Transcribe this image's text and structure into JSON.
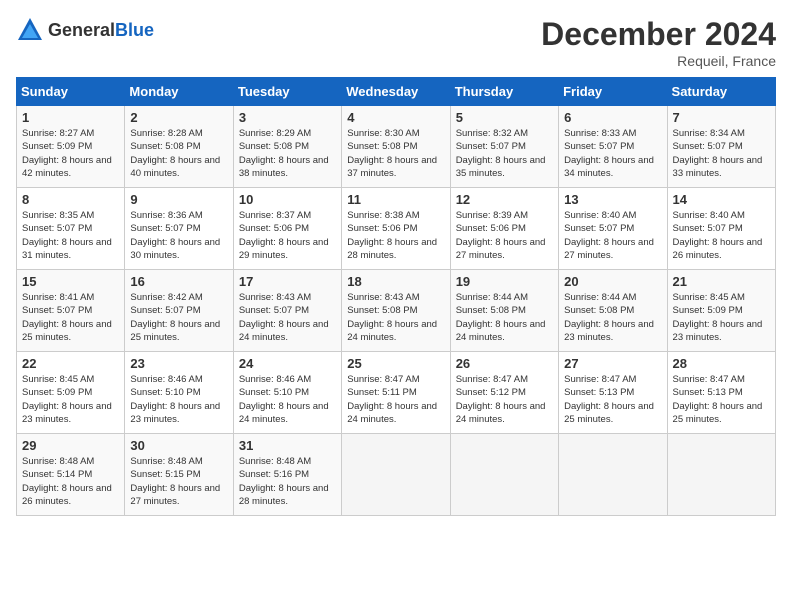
{
  "header": {
    "logo_general": "General",
    "logo_blue": "Blue",
    "month_title": "December 2024",
    "location": "Requeil, France"
  },
  "weekdays": [
    "Sunday",
    "Monday",
    "Tuesday",
    "Wednesday",
    "Thursday",
    "Friday",
    "Saturday"
  ],
  "weeks": [
    [
      {
        "day": "1",
        "sunrise": "Sunrise: 8:27 AM",
        "sunset": "Sunset: 5:09 PM",
        "daylight": "Daylight: 8 hours and 42 minutes."
      },
      {
        "day": "2",
        "sunrise": "Sunrise: 8:28 AM",
        "sunset": "Sunset: 5:08 PM",
        "daylight": "Daylight: 8 hours and 40 minutes."
      },
      {
        "day": "3",
        "sunrise": "Sunrise: 8:29 AM",
        "sunset": "Sunset: 5:08 PM",
        "daylight": "Daylight: 8 hours and 38 minutes."
      },
      {
        "day": "4",
        "sunrise": "Sunrise: 8:30 AM",
        "sunset": "Sunset: 5:08 PM",
        "daylight": "Daylight: 8 hours and 37 minutes."
      },
      {
        "day": "5",
        "sunrise": "Sunrise: 8:32 AM",
        "sunset": "Sunset: 5:07 PM",
        "daylight": "Daylight: 8 hours and 35 minutes."
      },
      {
        "day": "6",
        "sunrise": "Sunrise: 8:33 AM",
        "sunset": "Sunset: 5:07 PM",
        "daylight": "Daylight: 8 hours and 34 minutes."
      },
      {
        "day": "7",
        "sunrise": "Sunrise: 8:34 AM",
        "sunset": "Sunset: 5:07 PM",
        "daylight": "Daylight: 8 hours and 33 minutes."
      }
    ],
    [
      {
        "day": "8",
        "sunrise": "Sunrise: 8:35 AM",
        "sunset": "Sunset: 5:07 PM",
        "daylight": "Daylight: 8 hours and 31 minutes."
      },
      {
        "day": "9",
        "sunrise": "Sunrise: 8:36 AM",
        "sunset": "Sunset: 5:07 PM",
        "daylight": "Daylight: 8 hours and 30 minutes."
      },
      {
        "day": "10",
        "sunrise": "Sunrise: 8:37 AM",
        "sunset": "Sunset: 5:06 PM",
        "daylight": "Daylight: 8 hours and 29 minutes."
      },
      {
        "day": "11",
        "sunrise": "Sunrise: 8:38 AM",
        "sunset": "Sunset: 5:06 PM",
        "daylight": "Daylight: 8 hours and 28 minutes."
      },
      {
        "day": "12",
        "sunrise": "Sunrise: 8:39 AM",
        "sunset": "Sunset: 5:06 PM",
        "daylight": "Daylight: 8 hours and 27 minutes."
      },
      {
        "day": "13",
        "sunrise": "Sunrise: 8:40 AM",
        "sunset": "Sunset: 5:07 PM",
        "daylight": "Daylight: 8 hours and 27 minutes."
      },
      {
        "day": "14",
        "sunrise": "Sunrise: 8:40 AM",
        "sunset": "Sunset: 5:07 PM",
        "daylight": "Daylight: 8 hours and 26 minutes."
      }
    ],
    [
      {
        "day": "15",
        "sunrise": "Sunrise: 8:41 AM",
        "sunset": "Sunset: 5:07 PM",
        "daylight": "Daylight: 8 hours and 25 minutes."
      },
      {
        "day": "16",
        "sunrise": "Sunrise: 8:42 AM",
        "sunset": "Sunset: 5:07 PM",
        "daylight": "Daylight: 8 hours and 25 minutes."
      },
      {
        "day": "17",
        "sunrise": "Sunrise: 8:43 AM",
        "sunset": "Sunset: 5:07 PM",
        "daylight": "Daylight: 8 hours and 24 minutes."
      },
      {
        "day": "18",
        "sunrise": "Sunrise: 8:43 AM",
        "sunset": "Sunset: 5:08 PM",
        "daylight": "Daylight: 8 hours and 24 minutes."
      },
      {
        "day": "19",
        "sunrise": "Sunrise: 8:44 AM",
        "sunset": "Sunset: 5:08 PM",
        "daylight": "Daylight: 8 hours and 24 minutes."
      },
      {
        "day": "20",
        "sunrise": "Sunrise: 8:44 AM",
        "sunset": "Sunset: 5:08 PM",
        "daylight": "Daylight: 8 hours and 23 minutes."
      },
      {
        "day": "21",
        "sunrise": "Sunrise: 8:45 AM",
        "sunset": "Sunset: 5:09 PM",
        "daylight": "Daylight: 8 hours and 23 minutes."
      }
    ],
    [
      {
        "day": "22",
        "sunrise": "Sunrise: 8:45 AM",
        "sunset": "Sunset: 5:09 PM",
        "daylight": "Daylight: 8 hours and 23 minutes."
      },
      {
        "day": "23",
        "sunrise": "Sunrise: 8:46 AM",
        "sunset": "Sunset: 5:10 PM",
        "daylight": "Daylight: 8 hours and 23 minutes."
      },
      {
        "day": "24",
        "sunrise": "Sunrise: 8:46 AM",
        "sunset": "Sunset: 5:10 PM",
        "daylight": "Daylight: 8 hours and 24 minutes."
      },
      {
        "day": "25",
        "sunrise": "Sunrise: 8:47 AM",
        "sunset": "Sunset: 5:11 PM",
        "daylight": "Daylight: 8 hours and 24 minutes."
      },
      {
        "day": "26",
        "sunrise": "Sunrise: 8:47 AM",
        "sunset": "Sunset: 5:12 PM",
        "daylight": "Daylight: 8 hours and 24 minutes."
      },
      {
        "day": "27",
        "sunrise": "Sunrise: 8:47 AM",
        "sunset": "Sunset: 5:13 PM",
        "daylight": "Daylight: 8 hours and 25 minutes."
      },
      {
        "day": "28",
        "sunrise": "Sunrise: 8:47 AM",
        "sunset": "Sunset: 5:13 PM",
        "daylight": "Daylight: 8 hours and 25 minutes."
      }
    ],
    [
      {
        "day": "29",
        "sunrise": "Sunrise: 8:48 AM",
        "sunset": "Sunset: 5:14 PM",
        "daylight": "Daylight: 8 hours and 26 minutes."
      },
      {
        "day": "30",
        "sunrise": "Sunrise: 8:48 AM",
        "sunset": "Sunset: 5:15 PM",
        "daylight": "Daylight: 8 hours and 27 minutes."
      },
      {
        "day": "31",
        "sunrise": "Sunrise: 8:48 AM",
        "sunset": "Sunset: 5:16 PM",
        "daylight": "Daylight: 8 hours and 28 minutes."
      },
      null,
      null,
      null,
      null
    ]
  ]
}
